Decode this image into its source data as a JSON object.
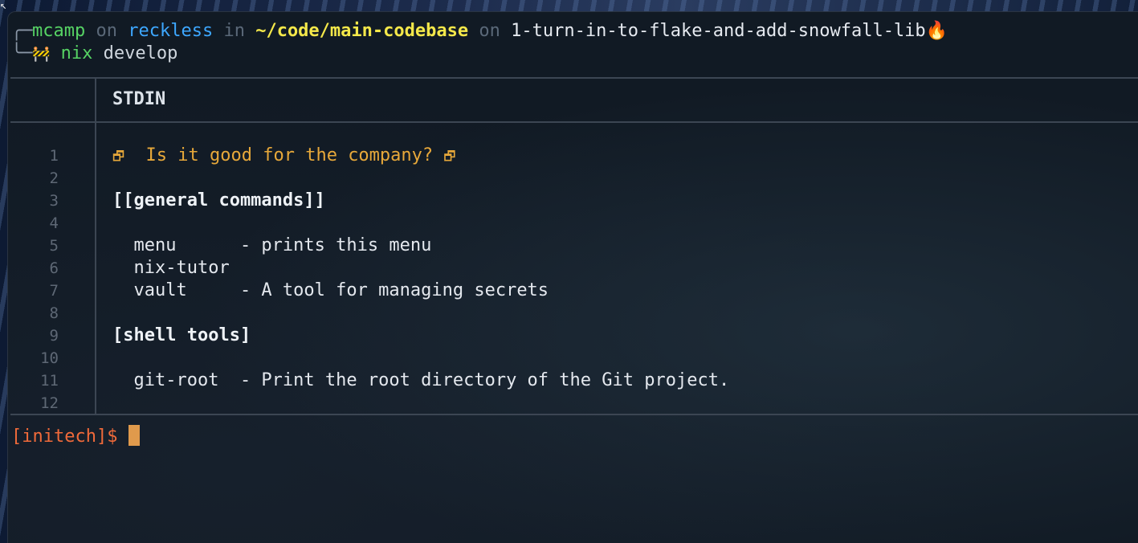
{
  "prompt": {
    "user": "mcamp",
    "on_word_1": "on",
    "host": "reckless",
    "in_word": "in",
    "path": "~/code/main-codebase",
    "on_word_2": "on",
    "branch": "1-turn-in-to-flake-and-add-snowfall-lib",
    "branch_icon": "fire-icon",
    "command_icon": "construction-icon",
    "command": "nix",
    "command_arg": "develop"
  },
  "bat": {
    "header": "STDIN",
    "line_numbers": [
      "1",
      "2",
      "3",
      "4",
      "5",
      "6",
      "7",
      "8",
      "9",
      "10",
      "11",
      "12"
    ],
    "lines": {
      "title": "Is it good for the company?",
      "l3": "[[general commands]]",
      "l5": "  menu      - prints this menu",
      "l6": "  nix-tutor",
      "l7": "  vault     - A tool for managing secrets",
      "l9": "[shell tools]",
      "l11": "  git-root  - Print the root directory of the Git project."
    }
  },
  "shell_prompt": "[initech]$ ",
  "colors": {
    "user": "#56d364",
    "host": "#3da7ff",
    "path": "#f4e84a",
    "title": "#e7a83a",
    "shell_prompt": "#f06a3a",
    "cursor": "#e09a4c"
  }
}
